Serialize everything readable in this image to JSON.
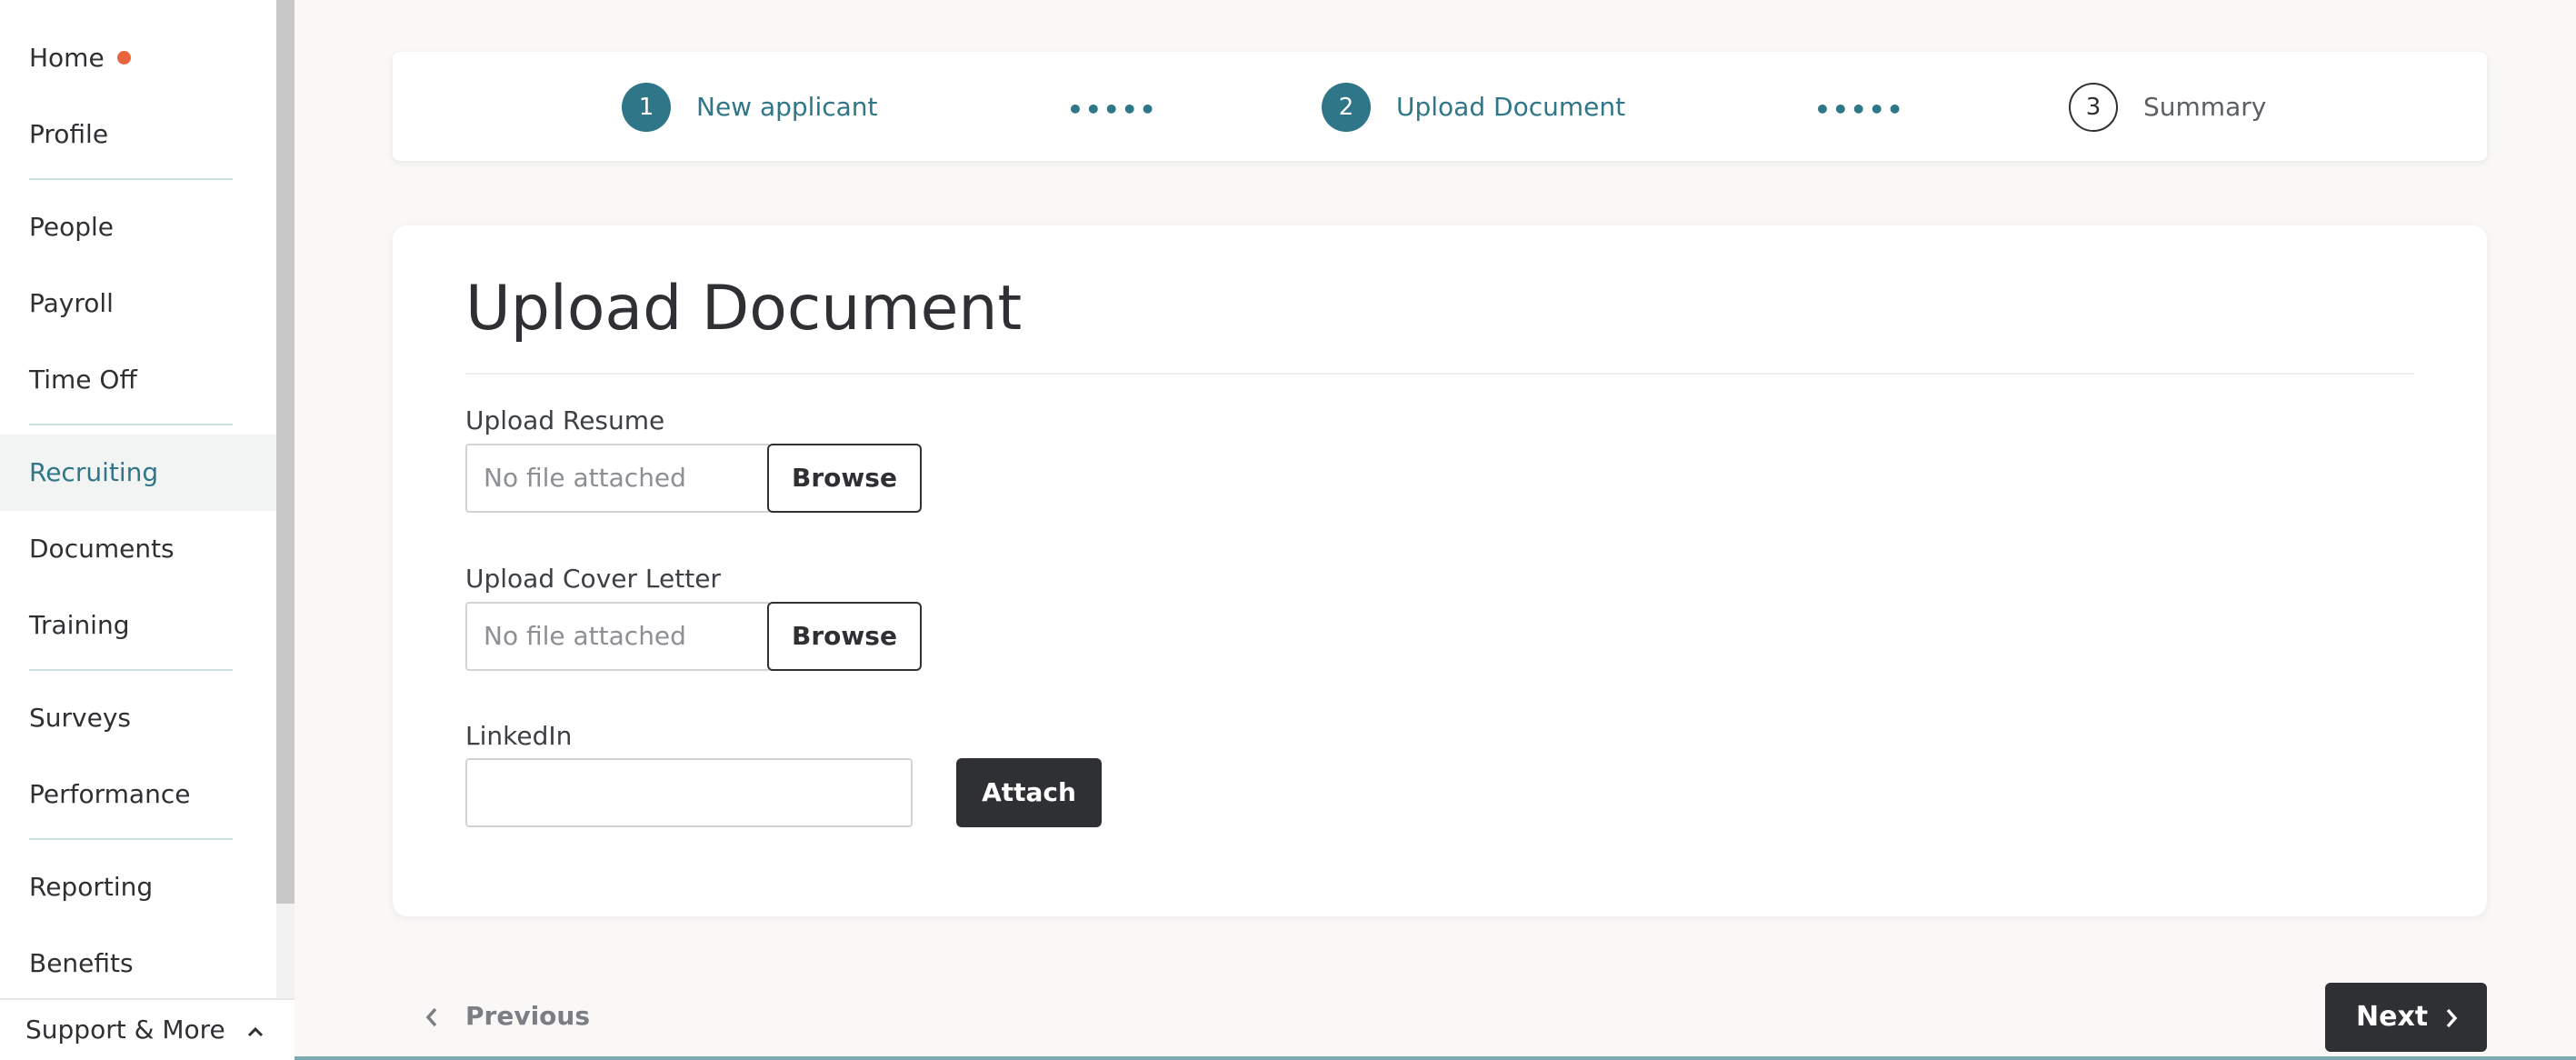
{
  "sidebar": {
    "items": [
      {
        "label": "Home"
      },
      {
        "label": "Profile"
      },
      {
        "label": "People"
      },
      {
        "label": "Payroll"
      },
      {
        "label": "Time Off"
      },
      {
        "label": "Recruiting"
      },
      {
        "label": "Documents"
      },
      {
        "label": "Training"
      },
      {
        "label": "Surveys"
      },
      {
        "label": "Performance"
      },
      {
        "label": "Reporting"
      },
      {
        "label": "Benefits"
      }
    ],
    "active_item": "Recruiting",
    "notification_color": "#e8643c",
    "support_label": "Support & More"
  },
  "stepper": {
    "steps": [
      {
        "number": "1",
        "label": "New applicant",
        "state": "complete"
      },
      {
        "number": "2",
        "label": "Upload Document",
        "state": "current"
      },
      {
        "number": "3",
        "label": "Summary",
        "state": "upcoming"
      }
    ],
    "separator": "•••••"
  },
  "form": {
    "title": "Upload Document",
    "resume": {
      "label": "Upload Resume",
      "placeholder": "No file attached",
      "button": "Browse"
    },
    "cover_letter": {
      "label": "Upload Cover Letter",
      "placeholder": "No file attached",
      "button": "Browse"
    },
    "linkedin": {
      "label": "LinkedIn",
      "value": "",
      "button": "Attach"
    }
  },
  "footer": {
    "previous_label": "Previous",
    "next_label": "Next"
  },
  "colors": {
    "accent": "#2f7689",
    "dark_button": "#2f3033",
    "page_background": "#f9f8f7"
  }
}
